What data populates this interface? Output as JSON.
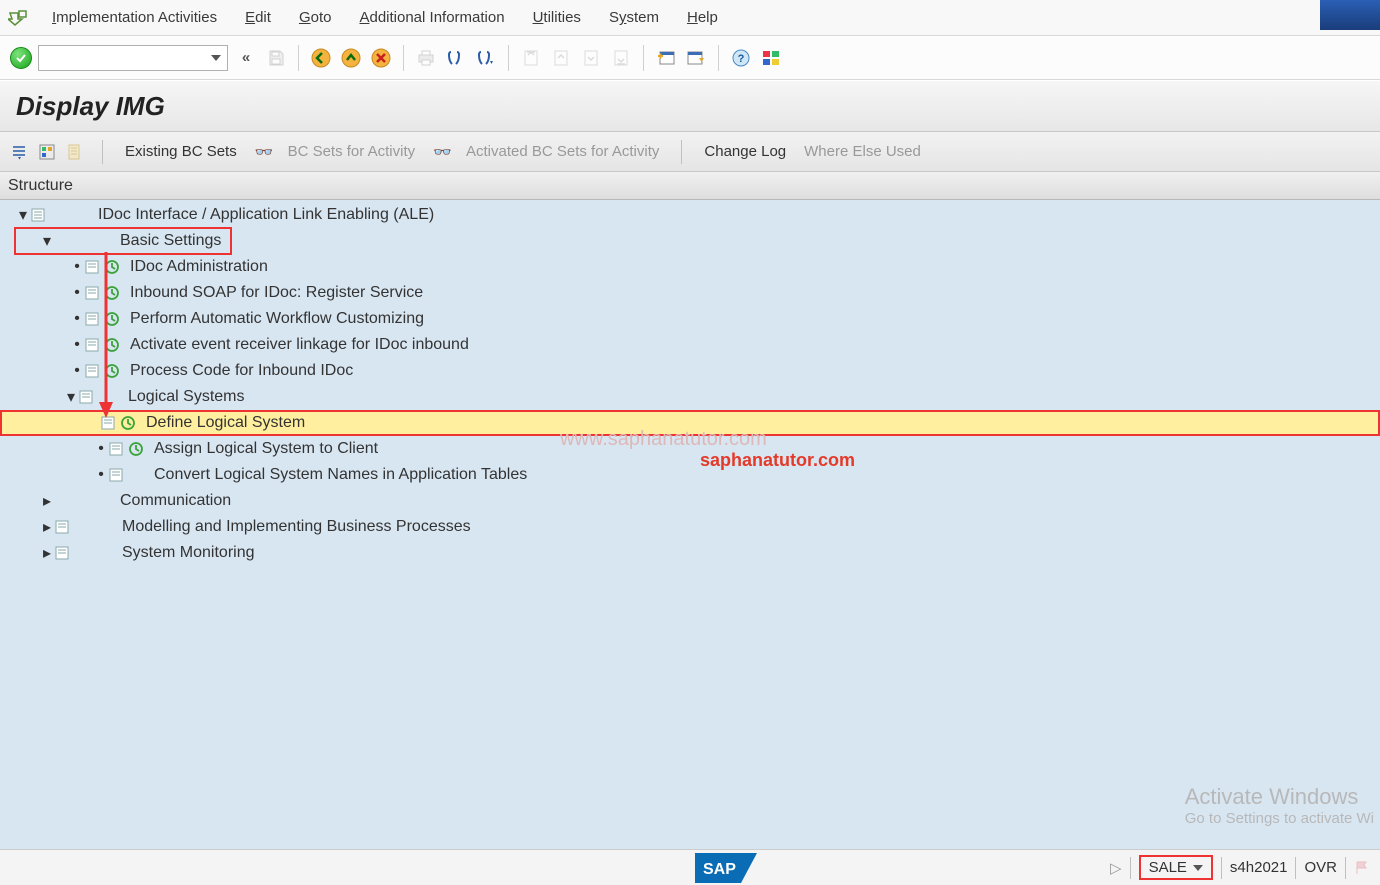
{
  "menubar": {
    "items": [
      {
        "pre": "",
        "ul": "I",
        "post": "mplementation Activities"
      },
      {
        "pre": "",
        "ul": "E",
        "post": "dit"
      },
      {
        "pre": "",
        "ul": "G",
        "post": "oto"
      },
      {
        "pre": "",
        "ul": "A",
        "post": "dditional Information"
      },
      {
        "pre": "",
        "ul": "U",
        "post": "tilities"
      },
      {
        "pre": "S",
        "ul": "y",
        "post": "stem"
      },
      {
        "pre": "",
        "ul": "H",
        "post": "elp"
      }
    ]
  },
  "title": "Display IMG",
  "sec_toolbar": {
    "existing": "Existing BC Sets",
    "bc_for_activity": "BC Sets for Activity",
    "activated_bc": "Activated BC Sets for Activity",
    "change_log": "Change Log",
    "where_used": "Where Else Used"
  },
  "structure_label": "Structure",
  "tree": {
    "root": "IDoc Interface / Application Link Enabling (ALE)",
    "basic_settings": "Basic Settings",
    "items_basic": [
      "IDoc Administration",
      "Inbound SOAP for IDoc: Register Service",
      "Perform Automatic Workflow Customizing",
      "Activate event receiver linkage for IDoc inbound",
      "Process Code for Inbound IDoc"
    ],
    "logical_systems": "Logical Systems",
    "items_ls": [
      "Define Logical System",
      "Assign Logical System to Client",
      "Convert Logical System Names in Application Tables"
    ],
    "siblings": [
      "Communication",
      "Modelling and Implementing Business Processes",
      "System Monitoring"
    ]
  },
  "watermark1": "www.saphanatutor.com",
  "watermark2": "saphanatutor.com",
  "activate": {
    "t1": "Activate Windows",
    "t2": "Go to Settings to activate Wi"
  },
  "statusbar": {
    "tcode": "SALE",
    "sys": "s4h2021",
    "mode": "OVR"
  }
}
